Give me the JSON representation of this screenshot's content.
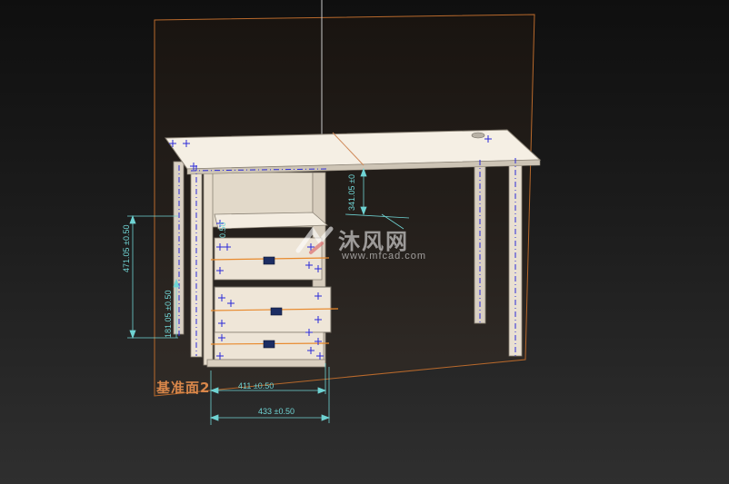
{
  "model": {
    "plane_label": "基准面2"
  },
  "dimensions": {
    "width_inner": "411 ±0.50",
    "width_outer": "433 ±0.50",
    "height_left": "471.05 ±0.50",
    "height_small": "181.05 ±0.50",
    "height_right": "341.05 ±0",
    "gap_small": "0.50"
  },
  "watermark": {
    "main": "沐风网",
    "sub": "www.mfcad.com"
  },
  "colors": {
    "dimension": "#6fd3d3",
    "plane": "#d9874a",
    "model_surface": "#efe6d8",
    "feature_marker": "#2a2ad8",
    "handle": "#1c2d63"
  }
}
